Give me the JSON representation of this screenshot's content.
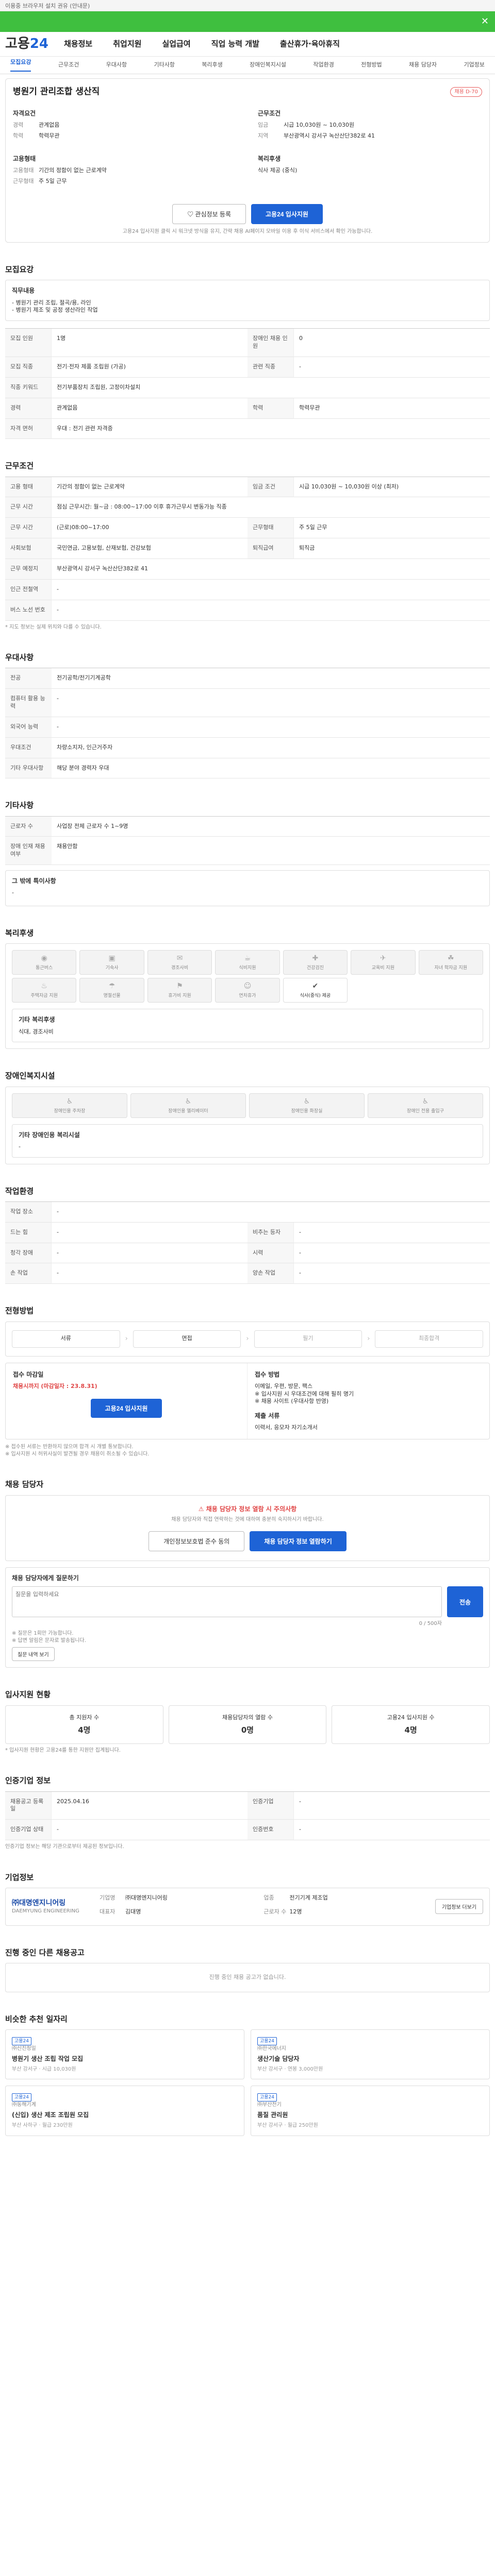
{
  "topbar": "이용중 브라우저 설치 권유 (안내문)",
  "header": {
    "logo_a": "고용",
    "logo_b": "24",
    "menu": [
      "채용정보",
      "취업지원",
      "실업급여",
      "직업 능력 개발",
      "출산휴가·육아휴직"
    ]
  },
  "tabs": [
    "모집요강",
    "근무조건",
    "우대사항",
    "기타사항",
    "복리후생",
    "장애인복지시설",
    "작업환경",
    "전형방법",
    "채용 담당자",
    "기업정보"
  ],
  "job": {
    "title": "병원기 관리조합 생산직",
    "badge": "채용 D-70",
    "left_label": "자격요건",
    "left": [
      {
        "k": "경력",
        "v": "관계없음"
      },
      {
        "k": "학력",
        "v": "학력무관"
      }
    ],
    "right_label": "근무조건",
    "right": [
      {
        "k": "임금",
        "v": "시급 10,030원 ~ 10,030원"
      },
      {
        "k": "지역",
        "v": "부산광역시 강서구 녹산산단382로 41"
      }
    ],
    "emp_label": "고용형태",
    "emp": [
      {
        "k": "고용형태",
        "v": "기간의 정함이 없는 근로계약"
      },
      {
        "k": "근무형태",
        "v": "주 5일 근무"
      }
    ],
    "welfare_label": "복리후생",
    "welfare": "식사 제공 (중식)",
    "btn_save": "관심정보 등록",
    "btn_apply": "고용24 입사지원",
    "note": "고용24 입사지원 클릭 시 워크넷 방식을 유지, 간략 채용 AI페이지 모바일 이용 후 이식 서비스에서 확인 가능합니다."
  },
  "recruit": {
    "title": "모집요강",
    "duty_label": "직무내용",
    "duty": [
      "- 병원기 관리 조립, 절곡/용, 라인",
      "- 병원기 제조 및 공정 생산라인 작업"
    ],
    "rows": [
      {
        "k": "모집 인원",
        "v": "1명",
        "k2": "장애인 채용 인원",
        "v2": "0"
      },
      {
        "k": "모집 직종",
        "v": "전기·전자 제품 조립원 (가공)",
        "k2": "관련 직종",
        "v2": "-"
      },
      {
        "k": "직종 키워드",
        "v": "전기부품장치 조립원, 고정이차설치",
        "k2": "",
        "v2": ""
      },
      {
        "k": "경력",
        "v": "관계없음",
        "k2": "학력",
        "v2": "학력무관"
      },
      {
        "k": "자격 면허",
        "v": "우대 : 전기 관련 자격증",
        "k2": "",
        "v2": ""
      }
    ]
  },
  "cond": {
    "title": "근무조건",
    "rows": [
      {
        "k": "고용 형태",
        "v": "기간의 정함이 없는 근로계약",
        "k2": "임금 조건",
        "v2": "시급 10,030원 ~ 10,030원 이상 (최저)"
      },
      {
        "k": "근무 시간",
        "v": "점심 근무시간: 월~금 : 08:00~17:00 이후 휴가근무시 변동가능 직종",
        "k2": "",
        "v2": ""
      },
      {
        "k": "근무 시간",
        "v": "(근로)08:00~17:00",
        "k2": "근무형태",
        "v2": "주 5일 근무"
      },
      {
        "k": "사회보험",
        "v": "국민연금, 고용보험, 산재보험, 건강보험",
        "k2": "퇴직급여",
        "v2": "퇴직금"
      },
      {
        "k": "근무 예정지",
        "v": "부산광역시 강서구 녹산산단382로 41",
        "k2": "",
        "v2": ""
      },
      {
        "k": "인근 전철역",
        "v": "-",
        "k2": "",
        "v2": ""
      },
      {
        "k": "버스 노선 번호",
        "v": "-",
        "k2": "",
        "v2": ""
      }
    ],
    "note": "* 지도 정보는 실제 위치와 다를 수 있습니다."
  },
  "pref": {
    "title": "우대사항",
    "rows": [
      {
        "k": "전공",
        "v": "전기공학/전기기계공학"
      },
      {
        "k": "컴퓨터 활용 능력",
        "v": "-"
      },
      {
        "k": "외국어 능력",
        "v": "-"
      },
      {
        "k": "우대조건",
        "v": "차량소지자, 인근거주자"
      },
      {
        "k": "기타 우대사항",
        "v": "해당 분야 경력자 우대"
      }
    ]
  },
  "etc": {
    "title": "기타사항",
    "rows": [
      {
        "k": "근로자 수",
        "v": "사업장 전체 근로자 수 1~9명"
      },
      {
        "k": "장애 인재 채용 여부",
        "v": "채용안함"
      }
    ],
    "detail_label": "그 밖에 특이사항",
    "detail": "-"
  },
  "welfare": {
    "title": "복리후생",
    "items": [
      {
        "g": "◉",
        "t": "통근버스"
      },
      {
        "g": "▣",
        "t": "기숙사"
      },
      {
        "g": "✉",
        "t": "경조사비"
      },
      {
        "g": "☕",
        "t": "식비지원"
      },
      {
        "g": "✚",
        "t": "건강검진"
      },
      {
        "g": "✈",
        "t": "교육비 지원"
      },
      {
        "g": "☘",
        "t": "자녀 학자금 지원"
      },
      {
        "g": "♨",
        "t": "주택자금 지원"
      },
      {
        "g": "☂",
        "t": "명절선물"
      },
      {
        "g": "⚑",
        "t": "휴가비 지원"
      },
      {
        "g": "☺",
        "t": "연차휴가"
      },
      {
        "g": "✔",
        "t": "식사(중식) 제공"
      }
    ],
    "other_label": "기타 복리후생",
    "other": "식대, 경조사비"
  },
  "disab": {
    "title": "장애인복지시설",
    "items": [
      "장애인용 주차장",
      "장애인용 엘리베이터",
      "장애인용 화장실",
      "장애인 전용 출입구"
    ],
    "other_label": "기타 장애인용 복리시설",
    "other": "-"
  },
  "env": {
    "title": "작업환경",
    "rows": [
      {
        "k": "작업 장소",
        "v": "-",
        "k2": "",
        "v2": ""
      },
      {
        "k": "드는 힘",
        "v": "-",
        "k2": "비추는 등자",
        "v2": "-"
      },
      {
        "k": "청각 장애",
        "v": "-",
        "k2": "시력",
        "v2": "-"
      },
      {
        "k": "손 작업",
        "v": "-",
        "k2": "양손 작업",
        "v2": "-"
      }
    ]
  },
  "sel": {
    "title": "전형방법",
    "steps": [
      "서류",
      "면접",
      "필기",
      "최종합격"
    ],
    "accept_label": "접수 마감일",
    "accept_val": "채용시까지 (마감일자 : 23.8.31)",
    "method_label": "접수 방법",
    "method": [
      "이메일, 우편, 방문, 팩스",
      "※ 입사지원 시 우대조건에 대해 필히 명기",
      "※ 채용 사이트 (우대사항 반영)"
    ],
    "docs_label": "제출 서류",
    "docs": "이력서, 응모자 자기소개서",
    "apply_btn": "고용24 입사지원",
    "notes": [
      "※ 접수된 서류는 반환하지 않으며 합격 시 개별 통보합니다.",
      "※ 입사지원 시 허위사실이 발견될 경우 채용이 취소될 수 있습니다."
    ]
  },
  "manager": {
    "title": "채용 담당자",
    "warn": "채용 담당자 정보 열람 시 주의사항",
    "warn_sub": "채용 담당자와 직접 연락하는 것에 대하여 충분히 숙지하시기 바랍니다.",
    "btn1": "개인정보보호법 준수 동의",
    "btn2": "채용 담당자 정보 열람하기",
    "q_label": "채용 담당자에게 질문하기",
    "q_placeholder": "질문을 입력하세요",
    "q_count": "0 / 500자",
    "q_btn": "전송",
    "q_notes": [
      "※ 질문은 1회만 가능합니다.",
      "※ 답변 알림은 문자로 발송됩니다."
    ],
    "q_btn2": "질문 내역 보기"
  },
  "stats": {
    "title": "입사지원 현황",
    "items": [
      {
        "t": "총 지원자 수",
        "n": "4명"
      },
      {
        "t": "채용담당자의 열람 수",
        "n": "0명"
      },
      {
        "t": "고용24 입사지원 수",
        "n": "4명"
      }
    ],
    "note": "* 입사지원 현황은 고용24를 통한 지원만 집계됩니다."
  },
  "info": {
    "title": "인증기업 정보",
    "rows": [
      {
        "k": "채용공고 등록일",
        "v": "2025.04.16",
        "k2": "인증기업",
        "v2": "-"
      },
      {
        "k": "인증기업 상태",
        "v": "-",
        "k2": "인증번호",
        "v2": "-"
      }
    ],
    "note": "인증기업 정보는 해당 기관으로부터 제공된 정보입니다."
  },
  "company": {
    "title": "기업정보",
    "name": "㈜대명엔지니어링",
    "en": "DAEMYUNG ENGINEERING",
    "rows": [
      {
        "k": "기업명",
        "v": "㈜대명엔지니어링"
      },
      {
        "k": "업종",
        "v": "전기기계 제조업"
      },
      {
        "k": "대표자",
        "v": "김대명"
      },
      {
        "k": "근로자 수",
        "v": "12명"
      }
    ],
    "btn": "기업정보 더보기"
  },
  "same": {
    "title": "진행 중인 다른 채용공고",
    "empty": "진행 중인 채용 공고가 없습니다."
  },
  "other": {
    "title": "비슷한 추천 일자리",
    "jobs": [
      {
        "co": "㈜신진정밀",
        "t": "병원기 생산 조립 작업 모집",
        "m": "부산 강서구 · 시급 10,030원",
        "tag": "고용24"
      },
      {
        "co": "㈜한국에너지",
        "t": "생산기술 담당자",
        "m": "부산 강서구 · 연봉 3,000만원",
        "tag": "고용24"
      },
      {
        "co": "㈜동해기계",
        "t": "(신입) 생산 제조 조립원 모집",
        "m": "부산 사하구 · 월급 230만원",
        "tag": "고용24"
      },
      {
        "co": "㈜부산전기",
        "t": "품질 관리원",
        "m": "부산 강서구 · 월급 250만원",
        "tag": "고용24"
      }
    ]
  }
}
